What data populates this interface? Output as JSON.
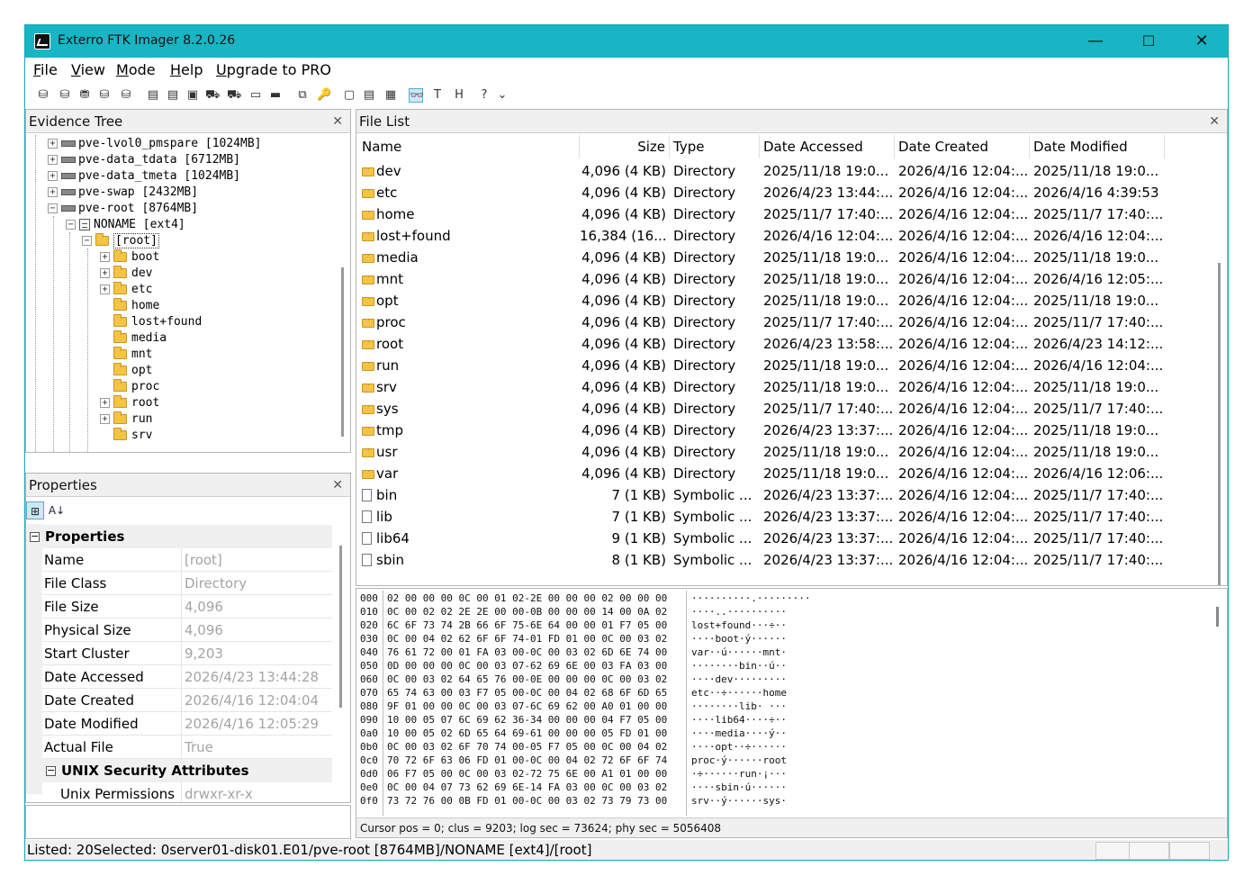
{
  "window": {
    "title": "Exterro FTK Imager 8.2.0.26",
    "minimize": "—",
    "maximize": "☐",
    "close": "✕"
  },
  "menu": [
    {
      "label": "File",
      "hotkey": "F",
      "rest": "ile"
    },
    {
      "label": "View",
      "hotkey": "V",
      "rest": "iew"
    },
    {
      "label": "Mode",
      "hotkey": "M",
      "rest": "ode"
    },
    {
      "label": "Help",
      "hotkey": "H",
      "rest": "elp"
    },
    {
      "label": "Upgrade to PRO",
      "hotkey": "U",
      "rest": "pgrade to PRO"
    }
  ],
  "toolbar": {
    "icons": [
      "add-evidence-icon",
      "add-all-evidence-icon",
      "image-mounting-icon",
      "remove-evidence-icon",
      "remove-all-icon",
      "create-disk-image-icon",
      "export-disk-image-icon",
      "export-logical-image-icon",
      "add-to-custom-image-icon",
      "create-custom-image-icon",
      "decrypt-icon",
      "memory-capture-icon",
      "obtain-protected-files-icon",
      "detect-efs-icon",
      "new-file-icon",
      "file-view-icon",
      "properties-view-icon",
      "natural-view-icon",
      "text-view-icon",
      "hex-view-icon",
      "help-icon",
      "dropdown-icon"
    ],
    "glyphs": [
      "⛁",
      "⛁",
      "⛃",
      "⛁",
      "⛁",
      "▤",
      "▤",
      "▣",
      "⛟",
      "⛟",
      "▭",
      "▬",
      "⧉",
      "🔑",
      "▢",
      "▤",
      "▦",
      "👓",
      "T",
      "H",
      "?",
      "⌄"
    ]
  },
  "evidence_tree": {
    "header": "Evidence Tree",
    "close": "✕",
    "items": [
      {
        "label": "pve-lvol0_pmspare [1024MB]"
      },
      {
        "label": "pve-data_tdata [6712MB]"
      },
      {
        "label": "pve-data_tmeta [1024MB]"
      },
      {
        "label": "pve-swap [2432MB]"
      },
      {
        "label": "pve-root [8764MB]"
      },
      {
        "label": "NONAME [ext4]"
      },
      {
        "label": "[root]"
      },
      {
        "label": "boot"
      },
      {
        "label": "dev"
      },
      {
        "label": "etc"
      },
      {
        "label": "home"
      },
      {
        "label": "lost+found"
      },
      {
        "label": "media"
      },
      {
        "label": "mnt"
      },
      {
        "label": "opt"
      },
      {
        "label": "proc"
      },
      {
        "label": "root"
      },
      {
        "label": "run"
      },
      {
        "label": "srv"
      }
    ]
  },
  "properties": {
    "header": "Properties",
    "close": "✕",
    "categorized_icon": "⊞",
    "alpha_icon": "A↓",
    "category1": "Properties",
    "category2": "UNIX Security Attributes",
    "collapse": "−",
    "rows": [
      {
        "key": "Name",
        "value": "[root]"
      },
      {
        "key": "File Class",
        "value": "Directory"
      },
      {
        "key": "File Size",
        "value": "4,096"
      },
      {
        "key": "Physical Size",
        "value": "4,096"
      },
      {
        "key": "Start Cluster",
        "value": "9,203"
      },
      {
        "key": "Date Accessed",
        "value": "2026/4/23 13:44:28"
      },
      {
        "key": "Date Created",
        "value": "2026/4/16 12:04:04"
      },
      {
        "key": "Date Modified",
        "value": "2026/4/16 12:05:29"
      },
      {
        "key": "Actual File",
        "value": "True"
      }
    ],
    "unix_rows": [
      {
        "key": "Unix Permissions",
        "value": "drwxr-xr-x"
      }
    ]
  },
  "file_list": {
    "header": "File List",
    "close": "✕",
    "columns": [
      "Name",
      "Size",
      "Type",
      "Date Accessed",
      "Date Created",
      "Date Modified"
    ],
    "rows": [
      {
        "name": "dev",
        "icon": "folder-icon",
        "size": "4,096 (4 KB)",
        "type": "Directory",
        "accessed": "2025/11/18 19:0...",
        "created": "2026/4/16 12:04:...",
        "modified": "2025/11/18 19:0..."
      },
      {
        "name": "etc",
        "icon": "folder-icon",
        "size": "4,096 (4 KB)",
        "type": "Directory",
        "accessed": "2026/4/23 13:44:...",
        "created": "2026/4/16 12:04:...",
        "modified": "2026/4/16 4:39:53"
      },
      {
        "name": "home",
        "icon": "folder-icon",
        "size": "4,096 (4 KB)",
        "type": "Directory",
        "accessed": "2025/11/7 17:40:...",
        "created": "2026/4/16 12:04:...",
        "modified": "2025/11/7 17:40:..."
      },
      {
        "name": "lost+found",
        "icon": "folder-icon",
        "size": "16,384 (16...",
        "type": "Directory",
        "accessed": "2026/4/16 12:04:...",
        "created": "2026/4/16 12:04:...",
        "modified": "2026/4/16 12:04:..."
      },
      {
        "name": "media",
        "icon": "folder-icon",
        "size": "4,096 (4 KB)",
        "type": "Directory",
        "accessed": "2025/11/18 19:0...",
        "created": "2026/4/16 12:04:...",
        "modified": "2025/11/18 19:0..."
      },
      {
        "name": "mnt",
        "icon": "folder-icon",
        "size": "4,096 (4 KB)",
        "type": "Directory",
        "accessed": "2025/11/18 19:0...",
        "created": "2026/4/16 12:04:...",
        "modified": "2026/4/16 12:05:..."
      },
      {
        "name": "opt",
        "icon": "folder-icon",
        "size": "4,096 (4 KB)",
        "type": "Directory",
        "accessed": "2025/11/18 19:0...",
        "created": "2026/4/16 12:04:...",
        "modified": "2025/11/18 19:0..."
      },
      {
        "name": "proc",
        "icon": "folder-icon",
        "size": "4,096 (4 KB)",
        "type": "Directory",
        "accessed": "2025/11/7 17:40:...",
        "created": "2026/4/16 12:04:...",
        "modified": "2025/11/7 17:40:..."
      },
      {
        "name": "root",
        "icon": "folder-icon",
        "size": "4,096 (4 KB)",
        "type": "Directory",
        "accessed": "2026/4/23 13:58:...",
        "created": "2026/4/16 12:04:...",
        "modified": "2026/4/23 14:12:..."
      },
      {
        "name": "run",
        "icon": "folder-icon",
        "size": "4,096 (4 KB)",
        "type": "Directory",
        "accessed": "2025/11/18 19:0...",
        "created": "2026/4/16 12:04:...",
        "modified": "2026/4/16 12:04:..."
      },
      {
        "name": "srv",
        "icon": "folder-icon",
        "size": "4,096 (4 KB)",
        "type": "Directory",
        "accessed": "2025/11/18 19:0...",
        "created": "2026/4/16 12:04:...",
        "modified": "2025/11/18 19:0..."
      },
      {
        "name": "sys",
        "icon": "folder-icon",
        "size": "4,096 (4 KB)",
        "type": "Directory",
        "accessed": "2025/11/7 17:40:...",
        "created": "2026/4/16 12:04:...",
        "modified": "2025/11/7 17:40:..."
      },
      {
        "name": "tmp",
        "icon": "folder-icon",
        "size": "4,096 (4 KB)",
        "type": "Directory",
        "accessed": "2026/4/23 13:37:...",
        "created": "2026/4/16 12:04:...",
        "modified": "2025/11/18 19:0..."
      },
      {
        "name": "usr",
        "icon": "folder-icon",
        "size": "4,096 (4 KB)",
        "type": "Directory",
        "accessed": "2025/11/18 19:0...",
        "created": "2026/4/16 12:04:...",
        "modified": "2025/11/18 19:0..."
      },
      {
        "name": "var",
        "icon": "folder-icon",
        "size": "4,096 (4 KB)",
        "type": "Directory",
        "accessed": "2025/11/18 19:0...",
        "created": "2026/4/16 12:04:...",
        "modified": "2026/4/16 12:06:..."
      },
      {
        "name": "bin",
        "icon": "file-icon",
        "size": "7 (1 KB)",
        "type": "Symbolic ...",
        "accessed": "2026/4/23 13:37:...",
        "created": "2026/4/16 12:04:...",
        "modified": "2025/11/7 17:40:..."
      },
      {
        "name": "lib",
        "icon": "file-icon",
        "size": "7 (1 KB)",
        "type": "Symbolic ...",
        "accessed": "2026/4/23 13:37:...",
        "created": "2026/4/16 12:04:...",
        "modified": "2025/11/7 17:40:..."
      },
      {
        "name": "lib64",
        "icon": "file-icon",
        "size": "9 (1 KB)",
        "type": "Symbolic ...",
        "accessed": "2026/4/23 13:37:...",
        "created": "2026/4/16 12:04:...",
        "modified": "2025/11/7 17:40:..."
      },
      {
        "name": "sbin",
        "icon": "file-icon",
        "size": "8 (1 KB)",
        "type": "Symbolic ...",
        "accessed": "2026/4/23 13:37:...",
        "created": "2026/4/16 12:04:...",
        "modified": "2025/11/7 17:40:..."
      }
    ]
  },
  "hex_view": {
    "lines": [
      {
        "off": "000",
        "hex": "02 00 00 00 0C 00 01 02-2E 00 00 00 02 00 00 00",
        "ascii": "··········.·········"
      },
      {
        "off": "010",
        "hex": "0C 00 02 02 2E 2E 00 00-0B 00 00 00 14 00 0A 02",
        "ascii": "····..··········"
      },
      {
        "off": "020",
        "hex": "6C 6F 73 74 2B 66 6F 75-6E 64 00 00 01 F7 05 00",
        "ascii": "lost+found···÷··"
      },
      {
        "off": "030",
        "hex": "0C 00 04 02 62 6F 6F 74-01 FD 01 00 0C 00 03 02",
        "ascii": "····boot·ý······"
      },
      {
        "off": "040",
        "hex": "76 61 72 00 01 FA 03 00-0C 00 03 02 6D 6E 74 00",
        "ascii": "var··ú······mnt·"
      },
      {
        "off": "050",
        "hex": "0D 00 00 00 0C 00 03 07-62 69 6E 00 03 FA 03 00",
        "ascii": "········bin··ú··"
      },
      {
        "off": "060",
        "hex": "0C 00 03 02 64 65 76 00-0E 00 00 00 0C 00 03 02",
        "ascii": "····dev·········"
      },
      {
        "off": "070",
        "hex": "65 74 63 00 03 F7 05 00-0C 00 04 02 68 6F 6D 65",
        "ascii": "etc··÷······home"
      },
      {
        "off": "080",
        "hex": "9F 01 00 00 0C 00 03 07-6C 69 62 00 A0 01 00 00",
        "ascii": "········lib· ···"
      },
      {
        "off": "090",
        "hex": "10 00 05 07 6C 69 62 36-34 00 00 00 04 F7 05 00",
        "ascii": "····lib64····÷··"
      },
      {
        "off": "0a0",
        "hex": "10 00 05 02 6D 65 64 69-61 00 00 00 05 FD 01 00",
        "ascii": "····media····ý··"
      },
      {
        "off": "0b0",
        "hex": "0C 00 03 02 6F 70 74 00-05 F7 05 00 0C 00 04 02",
        "ascii": "····opt··÷······"
      },
      {
        "off": "0c0",
        "hex": "70 72 6F 63 06 FD 01 00-0C 00 04 02 72 6F 6F 74",
        "ascii": "proc·ý······root"
      },
      {
        "off": "0d0",
        "hex": "06 F7 05 00 0C 00 03 02-72 75 6E 00 A1 01 00 00",
        "ascii": "·÷······run·¡···"
      },
      {
        "off": "0e0",
        "hex": "0C 00 04 07 73 62 69 6E-14 FA 03 00 0C 00 03 02",
        "ascii": "····sbin·ú······"
      },
      {
        "off": "0f0",
        "hex": "73 72 76 00 0B FD 01 00-0C 00 03 02 73 79 73 00",
        "ascii": "srv··ý······sys·"
      }
    ],
    "status": "Cursor pos = 0; clus = 9203; log sec = 73624; phy sec = 5056408"
  },
  "statusbar": {
    "text": "Listed: 20Selected: 0server01-disk01.E01/pve-root [8764MB]/NONAME [ext4]/[root]"
  },
  "colors": {
    "titlebar": "#18b5c4",
    "folder": "#f5c443",
    "disabled_value": "#a4a4a4"
  }
}
